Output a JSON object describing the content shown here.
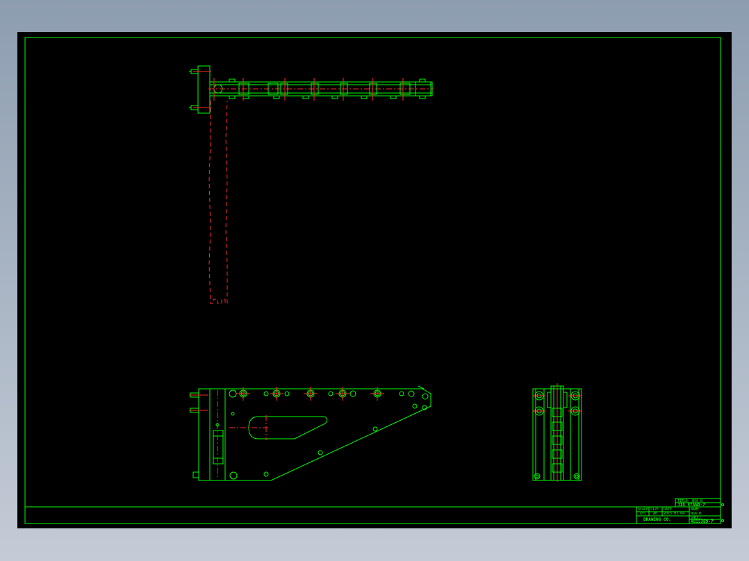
{
  "colors": {
    "background_top": "#8d9db0",
    "background_bottom": "#c4cbd6",
    "paper": "#000000",
    "line": "#00ff00",
    "center_line": "#ff2a2a"
  },
  "title_block": {
    "title_top": "TITLE: NS8-B",
    "title_sub": "JIG STAND-7",
    "scale_label": "SCALE",
    "scale_value": "1/5",
    "size_label": "SIZE",
    "size_value": "A0",
    "date_label": "DATE",
    "date_value": "2015.03.04",
    "name_label": "NAME",
    "name_value": "NS8-B",
    "company": "DRAWING CO.",
    "sheet_label": "SHEET",
    "drawing_number": "A015369-7"
  }
}
